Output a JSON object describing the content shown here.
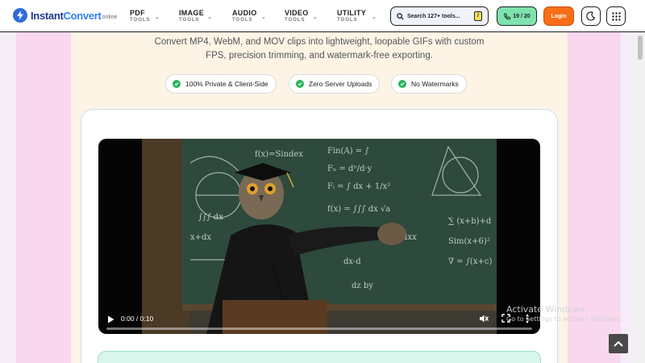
{
  "header": {
    "logo": {
      "brand": "Instant",
      "brand_accent": "Convert",
      "suffix": "online"
    },
    "nav": [
      {
        "title": "PDF",
        "sub": "TOOLS"
      },
      {
        "title": "IMAGE",
        "sub": "TOOLS"
      },
      {
        "title": "AUDIO",
        "sub": "TOOLS"
      },
      {
        "title": "VIDEO",
        "sub": "TOOLS"
      },
      {
        "title": "UTILITY",
        "sub": "TOOLS"
      }
    ],
    "search": {
      "placeholder": "Search 127+ tools...",
      "shortcut": "/"
    },
    "counter": "19 / 20",
    "login_label": "Login",
    "icons": [
      "lightning-bolt-icon",
      "chevron-down-icon",
      "search-icon",
      "phone-icon",
      "moon-icon",
      "grid-icon"
    ]
  },
  "hero": {
    "subtitle": "Convert MP4, WebM, and MOV clips into lightweight, loopable GIFs with custom FPS, precision trimming, and watermark-free exporting.",
    "badges": [
      "100% Private & Client-Side",
      "Zero Server Uploads",
      "No Watermarks"
    ]
  },
  "video": {
    "time": "0:00 / 0:10",
    "progress": 0,
    "icons": [
      "play-icon",
      "mute-icon",
      "fullscreen-icon",
      "more-options-icon"
    ]
  },
  "watermark": {
    "title": "Activate Windows",
    "subtitle": "Go to Settings to activate Windows."
  },
  "colors": {
    "accent_orange": "#f96d16",
    "accent_green": "#7ee2ae",
    "brand_blue": "#2e6cd9",
    "side_pink": "#f9d8ef",
    "center_cream": "#fdf4e6"
  }
}
